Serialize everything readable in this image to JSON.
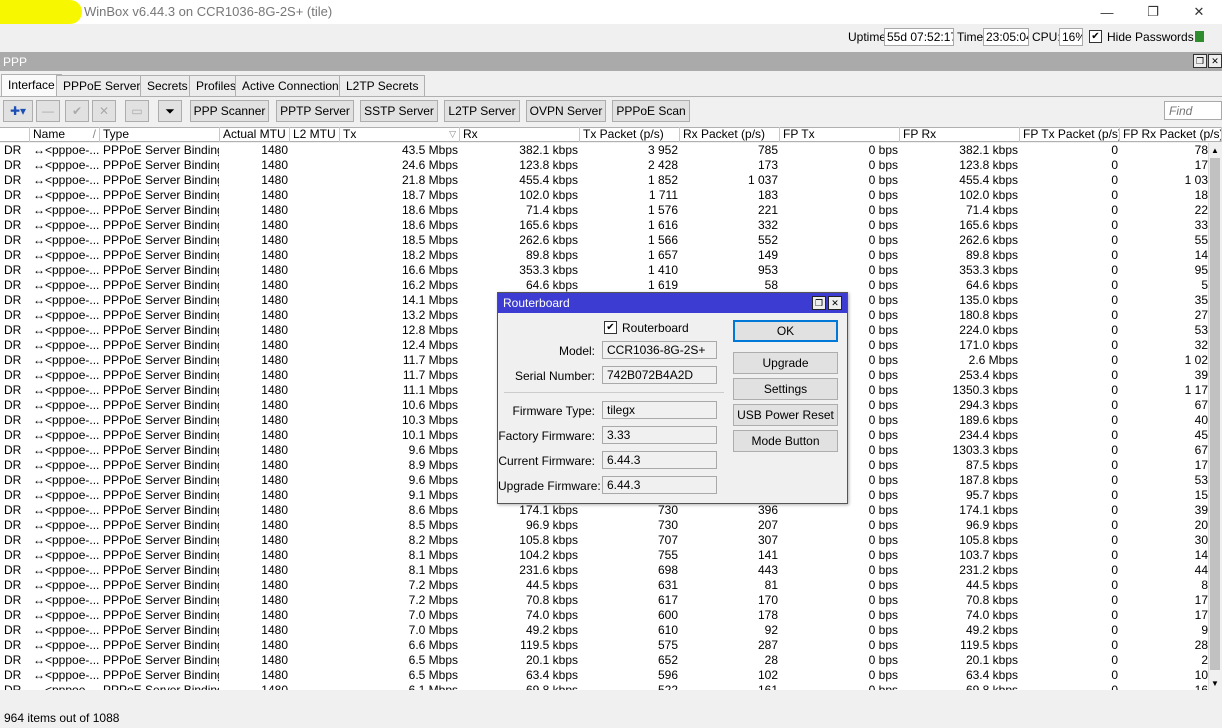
{
  "window": {
    "title": "WinBox v6.44.3 on CCR1036-8G-2S+ (tile)",
    "minimize_glyph": "—",
    "restore_glyph": "❐",
    "close_glyph": "✕"
  },
  "status": {
    "uptime_label": "Uptime:",
    "uptime_value": "55d 07:52:17",
    "time_label": "Time:",
    "time_value": "23:05:04",
    "cpu_label": "CPU:",
    "cpu_value": "16%",
    "hide_passwords_label": "Hide Passwords",
    "hide_passwords_checked": "✔"
  },
  "ppp": {
    "title": "PPP",
    "tabs": [
      "Interface",
      "PPPoE Servers",
      "Secrets",
      "Profiles",
      "Active Connections",
      "L2TP Secrets"
    ],
    "toolbar": {
      "add_glyph": "✚▾",
      "remove_glyph": "—",
      "enable_glyph": "✔",
      "disable_glyph": "✕",
      "comment_glyph": "▭",
      "filter_glyph": "⏷",
      "buttons": [
        "PPP Scanner",
        "PPTP Server",
        "SSTP Server",
        "L2TP Server",
        "OVPN Server",
        "PPPoE Scan"
      ],
      "find_placeholder": "Find"
    },
    "columns": [
      "",
      "Name",
      "Type",
      "Actual MTU",
      "L2 MTU",
      "Tx",
      "Rx",
      "Tx Packet (p/s)",
      "Rx Packet (p/s)",
      "FP Tx",
      "FP Rx",
      "FP Tx Packet (p/s)",
      "FP Rx Packet (p/s)"
    ],
    "sort_glyph": "/",
    "sort_glyph_tx": "▽",
    "rows": [
      [
        "DR",
        "↔<pppoe-...",
        "PPPoE Server Binding",
        "1480",
        "",
        "43.5 Mbps",
        "382.1 kbps",
        "3 952",
        "785",
        "0 bps",
        "382.1 kbps",
        "0",
        "78"
      ],
      [
        "DR",
        "↔<pppoe-...",
        "PPPoE Server Binding",
        "1480",
        "",
        "24.6 Mbps",
        "123.8 kbps",
        "2 428",
        "173",
        "0 bps",
        "123.8 kbps",
        "0",
        "17"
      ],
      [
        "DR",
        "↔<pppoe-...",
        "PPPoE Server Binding",
        "1480",
        "",
        "21.8 Mbps",
        "455.4 kbps",
        "1 852",
        "1 037",
        "0 bps",
        "455.4 kbps",
        "0",
        "1 03"
      ],
      [
        "DR",
        "↔<pppoe-...",
        "PPPoE Server Binding",
        "1480",
        "",
        "18.7 Mbps",
        "102.0 kbps",
        "1 711",
        "183",
        "0 bps",
        "102.0 kbps",
        "0",
        "18"
      ],
      [
        "DR",
        "↔<pppoe-...",
        "PPPoE Server Binding",
        "1480",
        "",
        "18.6 Mbps",
        "71.4 kbps",
        "1 576",
        "221",
        "0 bps",
        "71.4 kbps",
        "0",
        "22"
      ],
      [
        "DR",
        "↔<pppoe-...",
        "PPPoE Server Binding",
        "1480",
        "",
        "18.6 Mbps",
        "165.6 kbps",
        "1 616",
        "332",
        "0 bps",
        "165.6 kbps",
        "0",
        "33"
      ],
      [
        "DR",
        "↔<pppoe-...",
        "PPPoE Server Binding",
        "1480",
        "",
        "18.5 Mbps",
        "262.6 kbps",
        "1 566",
        "552",
        "0 bps",
        "262.6 kbps",
        "0",
        "55"
      ],
      [
        "DR",
        "↔<pppoe-...",
        "PPPoE Server Binding",
        "1480",
        "",
        "18.2 Mbps",
        "89.8 kbps",
        "1 657",
        "149",
        "0 bps",
        "89.8 kbps",
        "0",
        "14"
      ],
      [
        "DR",
        "↔<pppoe-...",
        "PPPoE Server Binding",
        "1480",
        "",
        "16.6 Mbps",
        "353.3 kbps",
        "1 410",
        "953",
        "0 bps",
        "353.3 kbps",
        "0",
        "95"
      ],
      [
        "DR",
        "↔<pppoe-...",
        "PPPoE Server Binding",
        "1480",
        "",
        "16.2 Mbps",
        "64.6 kbps",
        "1 619",
        "58",
        "0 bps",
        "64.6 kbps",
        "0",
        "5"
      ],
      [
        "DR",
        "↔<pppoe-...",
        "PPPoE Server Binding",
        "1480",
        "",
        "14.1 Mbps",
        "",
        "",
        "",
        "0 bps",
        "135.0 kbps",
        "0",
        "35"
      ],
      [
        "DR",
        "↔<pppoe-...",
        "PPPoE Server Binding",
        "1480",
        "",
        "13.2 Mbps",
        "",
        "",
        "",
        "0 bps",
        "180.8 kbps",
        "0",
        "27"
      ],
      [
        "DR",
        "↔<pppoe-...",
        "PPPoE Server Binding",
        "1480",
        "",
        "12.8 Mbps",
        "",
        "",
        "",
        "0 bps",
        "224.0 kbps",
        "0",
        "53"
      ],
      [
        "DR",
        "↔<pppoe-...",
        "PPPoE Server Binding",
        "1480",
        "",
        "12.4 Mbps",
        "",
        "",
        "",
        "0 bps",
        "171.0 kbps",
        "0",
        "32"
      ],
      [
        "DR",
        "↔<pppoe-...",
        "PPPoE Server Binding",
        "1480",
        "",
        "11.7 Mbps",
        "",
        "",
        "",
        "0 bps",
        "2.6 Mbps",
        "0",
        "1 02"
      ],
      [
        "DR",
        "↔<pppoe-...",
        "PPPoE Server Binding",
        "1480",
        "",
        "11.7 Mbps",
        "",
        "",
        "",
        "0 bps",
        "253.4 kbps",
        "0",
        "39"
      ],
      [
        "DR",
        "↔<pppoe-...",
        "PPPoE Server Binding",
        "1480",
        "",
        "11.1 Mbps",
        "",
        "",
        "",
        "0 bps",
        "1350.3 kbps",
        "0",
        "1 17"
      ],
      [
        "DR",
        "↔<pppoe-...",
        "PPPoE Server Binding",
        "1480",
        "",
        "10.6 Mbps",
        "",
        "",
        "",
        "0 bps",
        "294.3 kbps",
        "0",
        "67"
      ],
      [
        "DR",
        "↔<pppoe-...",
        "PPPoE Server Binding",
        "1480",
        "",
        "10.3 Mbps",
        "",
        "",
        "",
        "0 bps",
        "189.6 kbps",
        "0",
        "40"
      ],
      [
        "DR",
        "↔<pppoe-...",
        "PPPoE Server Binding",
        "1480",
        "",
        "10.1 Mbps",
        "",
        "",
        "",
        "0 bps",
        "234.4 kbps",
        "0",
        "45"
      ],
      [
        "DR",
        "↔<pppoe-...",
        "PPPoE Server Binding",
        "1480",
        "",
        "9.6 Mbps",
        "",
        "",
        "",
        "0 bps",
        "1303.3 kbps",
        "0",
        "67"
      ],
      [
        "DR",
        "↔<pppoe-...",
        "PPPoE Server Binding",
        "1480",
        "",
        "8.9 Mbps",
        "",
        "",
        "",
        "0 bps",
        "87.5 kbps",
        "0",
        "17"
      ],
      [
        "DR",
        "↔<pppoe-...",
        "PPPoE Server Binding",
        "1480",
        "",
        "9.6 Mbps",
        "",
        "",
        "",
        "0 bps",
        "187.8 kbps",
        "0",
        "53"
      ],
      [
        "DR",
        "↔<pppoe-...",
        "PPPoE Server Binding",
        "1480",
        "",
        "9.1 Mbps",
        "",
        "",
        "",
        "0 bps",
        "95.7 kbps",
        "0",
        "15"
      ],
      [
        "DR",
        "↔<pppoe-...",
        "PPPoE Server Binding",
        "1480",
        "",
        "8.6 Mbps",
        "174.1 kbps",
        "730",
        "396",
        "0 bps",
        "174.1 kbps",
        "0",
        "39"
      ],
      [
        "DR",
        "↔<pppoe-...",
        "PPPoE Server Binding",
        "1480",
        "",
        "8.5 Mbps",
        "96.9 kbps",
        "730",
        "207",
        "0 bps",
        "96.9 kbps",
        "0",
        "20"
      ],
      [
        "DR",
        "↔<pppoe-...",
        "PPPoE Server Binding",
        "1480",
        "",
        "8.2 Mbps",
        "105.8 kbps",
        "707",
        "307",
        "0 bps",
        "105.8 kbps",
        "0",
        "30"
      ],
      [
        "DR",
        "↔<pppoe-...",
        "PPPoE Server Binding",
        "1480",
        "",
        "8.1 Mbps",
        "104.2 kbps",
        "755",
        "141",
        "0 bps",
        "103.7 kbps",
        "0",
        "14"
      ],
      [
        "DR",
        "↔<pppoe-...",
        "PPPoE Server Binding",
        "1480",
        "",
        "8.1 Mbps",
        "231.6 kbps",
        "698",
        "443",
        "0 bps",
        "231.2 kbps",
        "0",
        "44"
      ],
      [
        "DR",
        "↔<pppoe-...",
        "PPPoE Server Binding",
        "1480",
        "",
        "7.2 Mbps",
        "44.5 kbps",
        "631",
        "81",
        "0 bps",
        "44.5 kbps",
        "0",
        "8"
      ],
      [
        "DR",
        "↔<pppoe-...",
        "PPPoE Server Binding",
        "1480",
        "",
        "7.2 Mbps",
        "70.8 kbps",
        "617",
        "170",
        "0 bps",
        "70.8 kbps",
        "0",
        "17"
      ],
      [
        "DR",
        "↔<pppoe-...",
        "PPPoE Server Binding",
        "1480",
        "",
        "7.0 Mbps",
        "74.0 kbps",
        "600",
        "178",
        "0 bps",
        "74.0 kbps",
        "0",
        "17"
      ],
      [
        "DR",
        "↔<pppoe-...",
        "PPPoE Server Binding",
        "1480",
        "",
        "7.0 Mbps",
        "49.2 kbps",
        "610",
        "92",
        "0 bps",
        "49.2 kbps",
        "0",
        "9"
      ],
      [
        "DR",
        "↔<pppoe-...",
        "PPPoE Server Binding",
        "1480",
        "",
        "6.6 Mbps",
        "119.5 kbps",
        "575",
        "287",
        "0 bps",
        "119.5 kbps",
        "0",
        "28"
      ],
      [
        "DR",
        "↔<pppoe-...",
        "PPPoE Server Binding",
        "1480",
        "",
        "6.5 Mbps",
        "20.1 kbps",
        "652",
        "28",
        "0 bps",
        "20.1 kbps",
        "0",
        "2"
      ],
      [
        "DR",
        "↔<pppoe-...",
        "PPPoE Server Binding",
        "1480",
        "",
        "6.5 Mbps",
        "63.4 kbps",
        "596",
        "102",
        "0 bps",
        "63.4 kbps",
        "0",
        "10"
      ],
      [
        "DR",
        "↔<pppoe-...",
        "PPPoE Server Binding",
        "1480",
        "",
        "6.1 Mbps",
        "69.8 kbps",
        "522",
        "161",
        "0 bps",
        "69.8 kbps",
        "0",
        "16"
      ]
    ],
    "items_count": "964 items out of 1088"
  },
  "dialog": {
    "title": "Routerboard",
    "routerboard_checked": "✔",
    "routerboard_label": "Routerboard",
    "model_label": "Model:",
    "model_value": "CCR1036-8G-2S+",
    "serial_label": "Serial Number:",
    "serial_value": "742B072B4A2D",
    "firmware_type_label": "Firmware Type:",
    "firmware_type_value": "tilegx",
    "factory_firmware_label": "Factory Firmware:",
    "factory_firmware_value": "3.33",
    "current_firmware_label": "Current Firmware:",
    "current_firmware_value": "6.44.3",
    "upgrade_firmware_label": "Upgrade Firmware:",
    "upgrade_firmware_value": "6.44.3",
    "buttons": {
      "ok": "OK",
      "upgrade": "Upgrade",
      "settings": "Settings",
      "usb_power_reset": "USB Power Reset",
      "mode_button": "Mode Button"
    },
    "restore_glyph": "❐",
    "close_glyph": "✕"
  },
  "scroll": {
    "up": "▲",
    "down": "▼"
  }
}
